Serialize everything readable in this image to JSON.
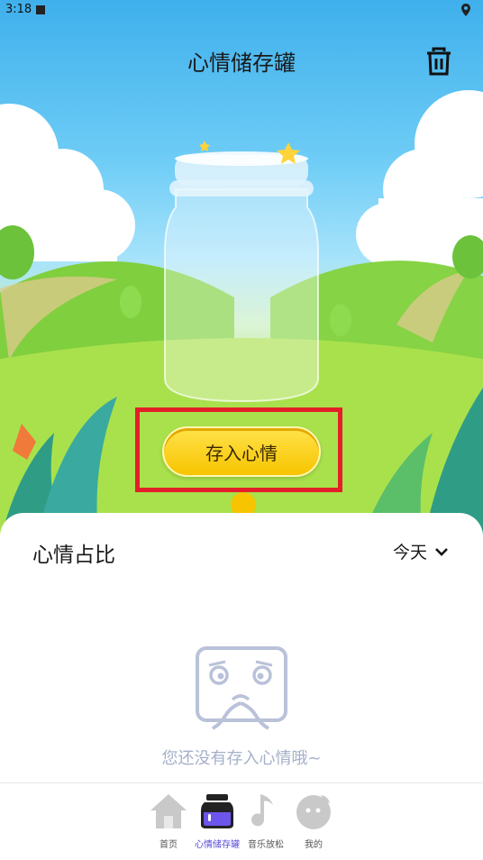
{
  "status_bar": {
    "time": "3:18"
  },
  "header": {
    "title": "心情储存罐"
  },
  "main": {
    "save_button_label": "存入心情"
  },
  "panel": {
    "title": "心情占比",
    "period": "今天",
    "empty_message": "您还没有存入心情哦~"
  },
  "tabbar": {
    "items": [
      {
        "label": "首页",
        "icon": "home-icon"
      },
      {
        "label": "心情储存罐",
        "icon": "jar-icon",
        "active": true
      },
      {
        "label": "音乐放松",
        "icon": "music-note-icon"
      },
      {
        "label": "我的",
        "icon": "profile-icon"
      }
    ]
  },
  "colors": {
    "accent": "#5a4bd8",
    "button_yellow": "#f7c400",
    "highlight_red": "#e3202a",
    "empty_text": "#a5b0c8"
  }
}
